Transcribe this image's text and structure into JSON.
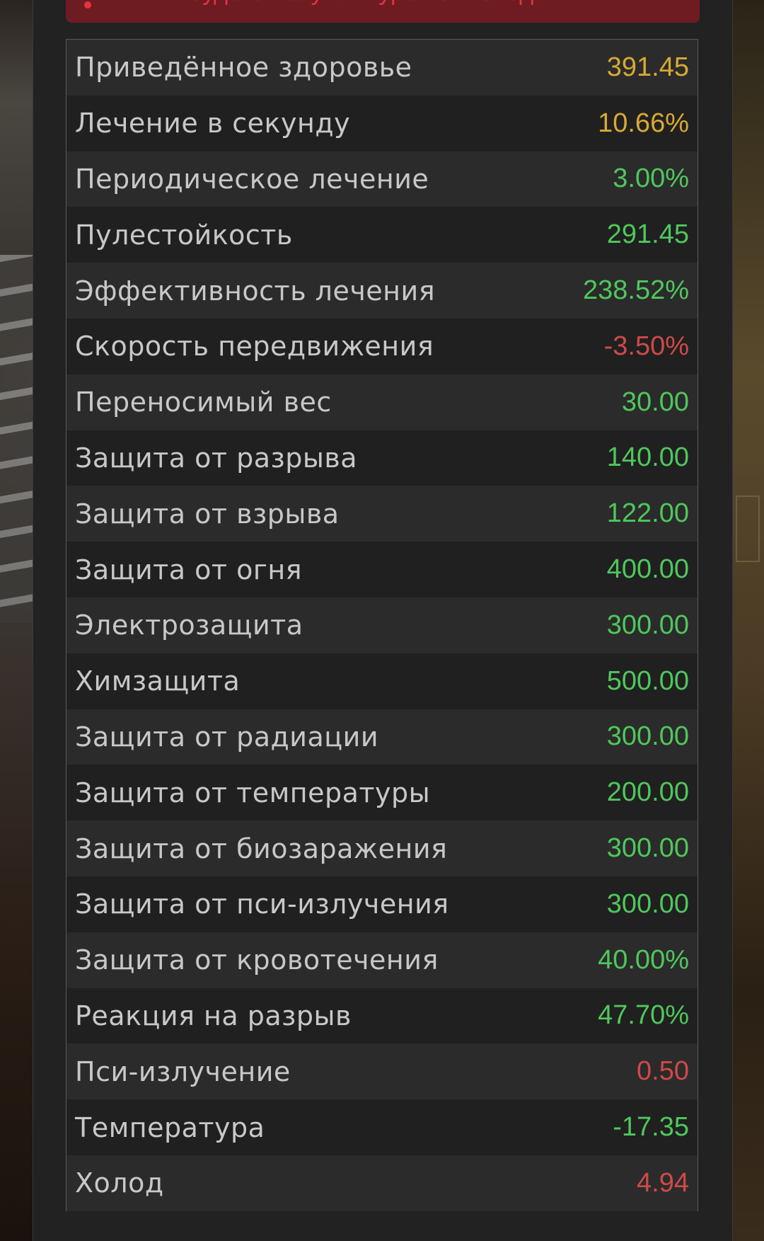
{
  "warning": {
    "text": "Вы будете получать урон от холода"
  },
  "colors": {
    "gold": "#d9a933",
    "green": "#4ec85c",
    "red": "#cf4a48",
    "warning_bg": "#6e1c22",
    "warning_text": "#e8323c"
  },
  "stats": [
    {
      "label": "Приведённое здоровье",
      "value": "391.45",
      "color": "gold"
    },
    {
      "label": "Лечение в секунду",
      "value": "10.66%",
      "color": "gold"
    },
    {
      "label": "Периодическое лечение",
      "value": "3.00%",
      "color": "green"
    },
    {
      "label": "Пулестойкость",
      "value": "291.45",
      "color": "green"
    },
    {
      "label": "Эффективность лечения",
      "value": "238.52%",
      "color": "green"
    },
    {
      "label": "Скорость передвижения",
      "value": "-3.50%",
      "color": "red"
    },
    {
      "label": "Переносимый вес",
      "value": "30.00",
      "color": "green"
    },
    {
      "label": "Защита от разрыва",
      "value": "140.00",
      "color": "green"
    },
    {
      "label": "Защита от взрыва",
      "value": "122.00",
      "color": "green"
    },
    {
      "label": "Защита от огня",
      "value": "400.00",
      "color": "green"
    },
    {
      "label": "Электрозащита",
      "value": "300.00",
      "color": "green"
    },
    {
      "label": "Химзащита",
      "value": "500.00",
      "color": "green"
    },
    {
      "label": "Защита от радиации",
      "value": "300.00",
      "color": "green"
    },
    {
      "label": "Защита от температуры",
      "value": "200.00",
      "color": "green"
    },
    {
      "label": "Защита от биозаражения",
      "value": "300.00",
      "color": "green"
    },
    {
      "label": "Защита от пси-излучения",
      "value": "300.00",
      "color": "green"
    },
    {
      "label": "Защита от кровотечения",
      "value": "40.00%",
      "color": "green"
    },
    {
      "label": "Реакция на разрыв",
      "value": "47.70%",
      "color": "green"
    },
    {
      "label": "Пси-излучение",
      "value": "0.50",
      "color": "red"
    },
    {
      "label": "Температура",
      "value": "-17.35",
      "color": "green"
    },
    {
      "label": "Холод",
      "value": "4.94",
      "color": "red"
    }
  ]
}
